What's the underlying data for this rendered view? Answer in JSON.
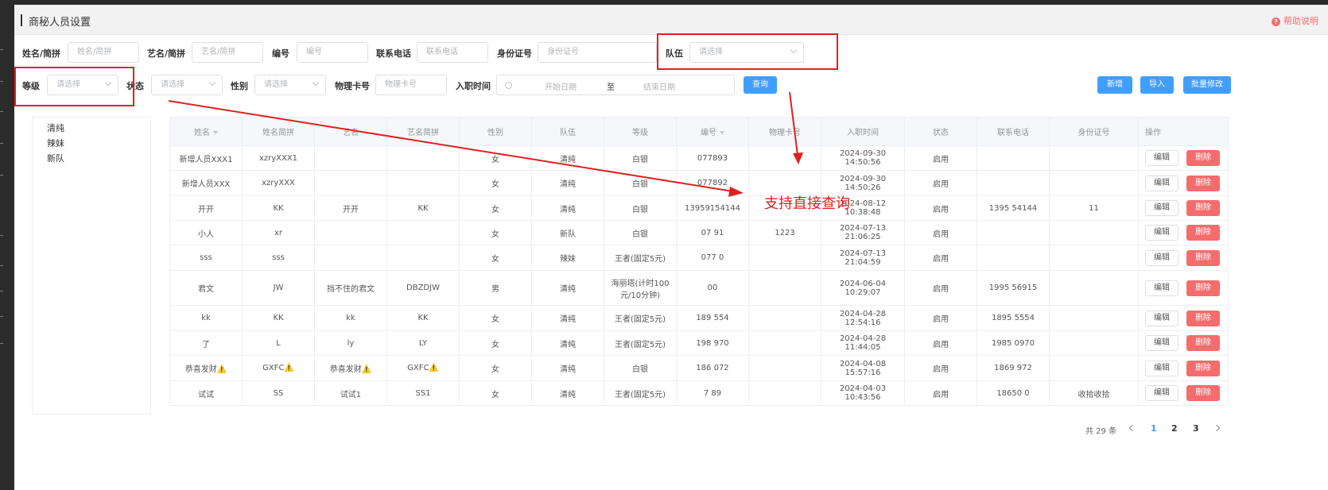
{
  "header": {
    "title": "商秘人员设置",
    "help": "帮助说明"
  },
  "filters": {
    "name": {
      "label": "姓名/简拼",
      "placeholder": "姓名/简拼"
    },
    "art_name": {
      "label": "艺名/简拼",
      "placeholder": "艺名/简拼"
    },
    "code": {
      "label": "编号",
      "placeholder": "编号"
    },
    "phone": {
      "label": "联系电话",
      "placeholder": "联系电话"
    },
    "id_card": {
      "label": "身份证号",
      "placeholder": "身份证号"
    },
    "team": {
      "label": "队伍",
      "placeholder": "请选择"
    },
    "level": {
      "label": "等级",
      "placeholder": "请选择"
    },
    "status": {
      "label": "状态",
      "placeholder": "请选择"
    },
    "gender": {
      "label": "性别",
      "placeholder": "请选择"
    },
    "card": {
      "label": "物理卡号",
      "placeholder": "物理卡号"
    },
    "join": {
      "label": "入职时间",
      "start": "开始日期",
      "to": "至",
      "end": "结束日期"
    }
  },
  "buttons": {
    "query": "查询",
    "add": "新增",
    "import": "导入",
    "batch": "批量修改",
    "edit": "编辑",
    "delete": "删除"
  },
  "teams": [
    "清纯",
    "辣妹",
    "新队"
  ],
  "table": {
    "headers": [
      "姓名",
      "姓名简拼",
      "艺名",
      "艺名简拼",
      "性别",
      "队伍",
      "等级",
      "编号",
      "物理卡号",
      "入职时间",
      "状态",
      "联系电话",
      "身份证号",
      "操作"
    ],
    "rows": [
      [
        "新增人员XXX1",
        "xzryXXX1",
        "",
        "",
        "女",
        "清纯",
        "白银",
        "077893",
        "",
        "2024-09-30 14:50:56",
        "启用",
        "",
        ""
      ],
      [
        "新增人员XXX",
        "xzryXXX",
        "",
        "",
        "女",
        "清纯",
        "白银",
        "077892",
        "",
        "2024-09-30 14:50:26",
        "启用",
        "",
        ""
      ],
      [
        "开开",
        "KK",
        "开开",
        "KK",
        "女",
        "清纯",
        "白银",
        "13959154144",
        "",
        "2024-08-12 10:38:48",
        "启用",
        "1395 54144",
        "11"
      ],
      [
        "小人",
        "xr",
        "",
        "",
        "女",
        "新队",
        "白银",
        "07 91",
        "1223",
        "2024-07-13 21:06:25",
        "启用",
        "",
        ""
      ],
      [
        "sss",
        "sss",
        "",
        "",
        "女",
        "辣妹",
        "王者(固定5元)",
        "077 0",
        "",
        "2024-07-13 21:04:59",
        "启用",
        "",
        ""
      ],
      [
        "君文",
        "JW",
        "挡不住的君文",
        "DBZDJW",
        "男",
        "清纯",
        "海丽塔(计时100元/10分钟)",
        "00",
        "",
        "2024-06-04 10:29:07",
        "启用",
        "1995 56915",
        ""
      ],
      [
        "kk",
        "KK",
        "kk",
        "KK",
        "女",
        "清纯",
        "王者(固定5元)",
        "189 554",
        "",
        "2024-04-28 12:54:16",
        "启用",
        "1895 5554",
        ""
      ],
      [
        "了",
        "L",
        "ly",
        "LY",
        "女",
        "清纯",
        "王者(固定5元)",
        "198 970",
        "",
        "2024-04-28 11:44:05",
        "启用",
        "1985 0970",
        ""
      ],
      [
        "恭喜发财⚠️",
        "GXFC⚠️",
        "恭喜发财⚠️",
        "GXFC⚠️",
        "女",
        "清纯",
        "白银",
        "186 072",
        "",
        "2024-04-08 15:57:16",
        "启用",
        "1869 972",
        ""
      ],
      [
        "试试",
        "SS",
        "试试1",
        "SS1",
        "女",
        "清纯",
        "王者(固定5元)",
        "7 89",
        "",
        "2024-04-03 10:43:56",
        "启用",
        "18650 0",
        "收拾收拾"
      ]
    ]
  },
  "annotation": "支持直接查询",
  "pagination": {
    "total": "共 29 条",
    "pages": [
      "1",
      "2",
      "3"
    ],
    "current": "1"
  }
}
